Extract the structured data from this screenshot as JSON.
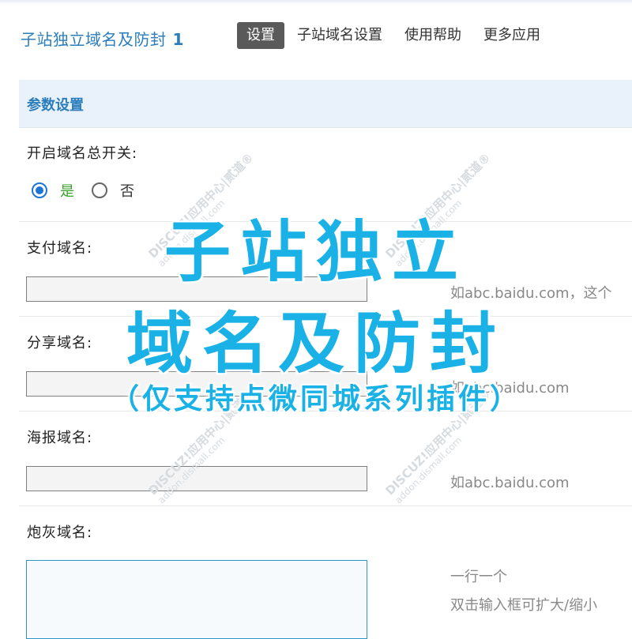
{
  "header": {
    "title": "子站独立域名及防封",
    "version": "1",
    "tabs": [
      {
        "label": "设置",
        "active": true
      },
      {
        "label": "子站域名设置",
        "active": false
      },
      {
        "label": "使用帮助",
        "active": false
      },
      {
        "label": "更多应用",
        "active": false
      }
    ]
  },
  "section": {
    "title": "参数设置"
  },
  "form": {
    "master_switch": {
      "label": "开启域名总开关:",
      "options": [
        {
          "label": "是",
          "checked": true
        },
        {
          "label": "否",
          "checked": false
        }
      ]
    },
    "pay_domain": {
      "label": "支付域名:",
      "value": "",
      "hint": "如abc.baidu.com，这个"
    },
    "share_domain": {
      "label": "分享域名:",
      "value": "",
      "hint": "如abc.baidu.com"
    },
    "poster_domain": {
      "label": "海报域名:",
      "value": "",
      "hint": "如abc.baidu.com"
    },
    "cannon_domain": {
      "label": "炮灰域名:",
      "value": "",
      "hint_1": "一行一个",
      "hint_2": "双击输入框可扩大/缩小"
    }
  },
  "watermark": {
    "line1": "DISCUZ!应用中心|贰道®",
    "line2": "addon.dismall.com"
  },
  "banner": {
    "line1": "子站独立",
    "line2": "域名及防封",
    "line3": "（仅支持点微同城系列插件）"
  },
  "colors": {
    "accent": "#2b7dbc",
    "banner": "#19b1e6",
    "active_tab": "#5a5a5a",
    "radio_checked": "#1e74d6"
  }
}
